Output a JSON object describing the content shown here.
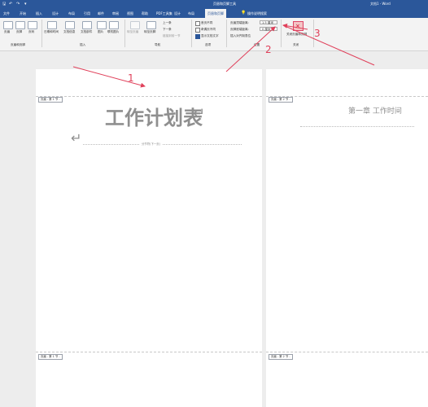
{
  "titlebar": {
    "context_tool": "页眉和页脚工具",
    "doc_title": "文档1 - Word"
  },
  "tabs": [
    "文件",
    "开始",
    "插入",
    "设计",
    "布局",
    "引用",
    "邮件",
    "审阅",
    "视图",
    "帮助",
    "PDF工具集"
  ],
  "active_tab": "页眉和页脚",
  "tell_me": "操作说明搜索",
  "ribbon": {
    "group1": {
      "buttons": [
        "页眉",
        "页脚",
        "页码"
      ],
      "label": "页眉和页脚"
    },
    "group2": {
      "buttons": [
        "日期和时间",
        "文档信息",
        "文档部件",
        "图片",
        "联机图片"
      ],
      "label": "插入"
    },
    "group3": {
      "buttons": [
        "转至页眉",
        "转至页脚"
      ],
      "prev": "上一条",
      "next": "下一条",
      "link": "链接到前一节",
      "label": "导航"
    },
    "group4": {
      "options": [
        "首页不同",
        "奇偶页不同",
        "显示文档文字"
      ],
      "label": "选项"
    },
    "group5": {
      "header_pos_label": "页眉顶端距离:",
      "footer_pos_label": "页脚底端距离:",
      "header_pos_value": "1.5 厘米",
      "footer_pos_value": "0 厘米",
      "align_tab": "插入对齐制表位",
      "label": "位置"
    },
    "group6": {
      "button": "关闭页眉和页脚",
      "label": "关闭"
    }
  },
  "document": {
    "page1": {
      "header_tag": "页眉 - 第 1 节 -",
      "title": "工作计划表",
      "para_mark": "↵",
      "section_break": "分节符(下一页)",
      "header_tag_bottom": "页眉 - 第 1 节 -"
    },
    "page2": {
      "header_tag": "页眉 - 第 2 节 -",
      "heading": "第一章 工作时间",
      "header_tag_bottom": "页眉 - 第 2 节 -"
    }
  },
  "annotations": [
    "1",
    "2",
    "3"
  ],
  "colors": {
    "accent": "#2b579a",
    "annotation": "#e0405a"
  }
}
